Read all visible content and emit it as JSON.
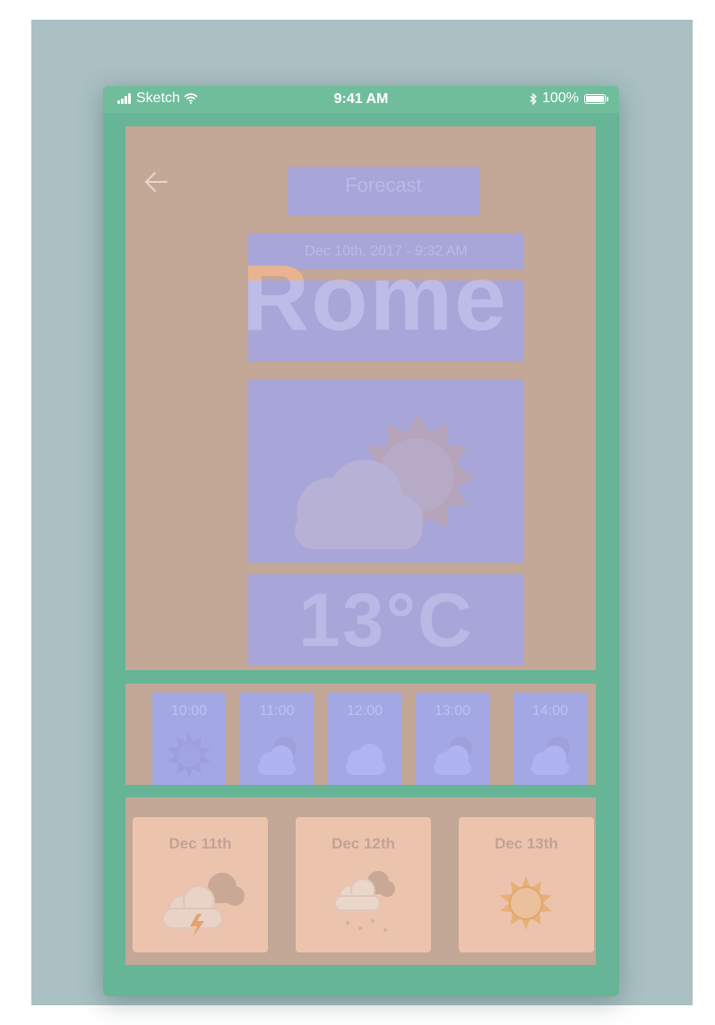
{
  "status_bar": {
    "carrier": "Sketch",
    "time": "9:41 AM",
    "battery": "100%"
  },
  "header": {
    "title": "Forecast",
    "back_icon": "arrow-left-icon"
  },
  "current": {
    "datetime": "Dec 10th, 2017 - 9:32 AM",
    "city": "Rome",
    "condition_icon": "partly-cloudy-icon",
    "temperature": "13°C"
  },
  "hourly": [
    {
      "time": "10:00",
      "icon": "sun-icon"
    },
    {
      "time": "11:00",
      "icon": "partly-cloudy-icon"
    },
    {
      "time": "12:00",
      "icon": "cloud-icon"
    },
    {
      "time": "13:00",
      "icon": "partly-cloudy-icon"
    },
    {
      "time": "14:00",
      "icon": "partly-cloudy-icon"
    }
  ],
  "daily": [
    {
      "label": "Dec 11th",
      "icon": "thunderstorm-icon"
    },
    {
      "label": "Dec 12th",
      "icon": "snow-icon"
    },
    {
      "label": "Dec 13th",
      "icon": "sun-icon"
    }
  ],
  "colors": {
    "background": "#aac0c2",
    "phone": "#66b597",
    "panel": "#c3a797",
    "overlay_blue": "#a8a5d8",
    "card": "#ecc4ae"
  }
}
